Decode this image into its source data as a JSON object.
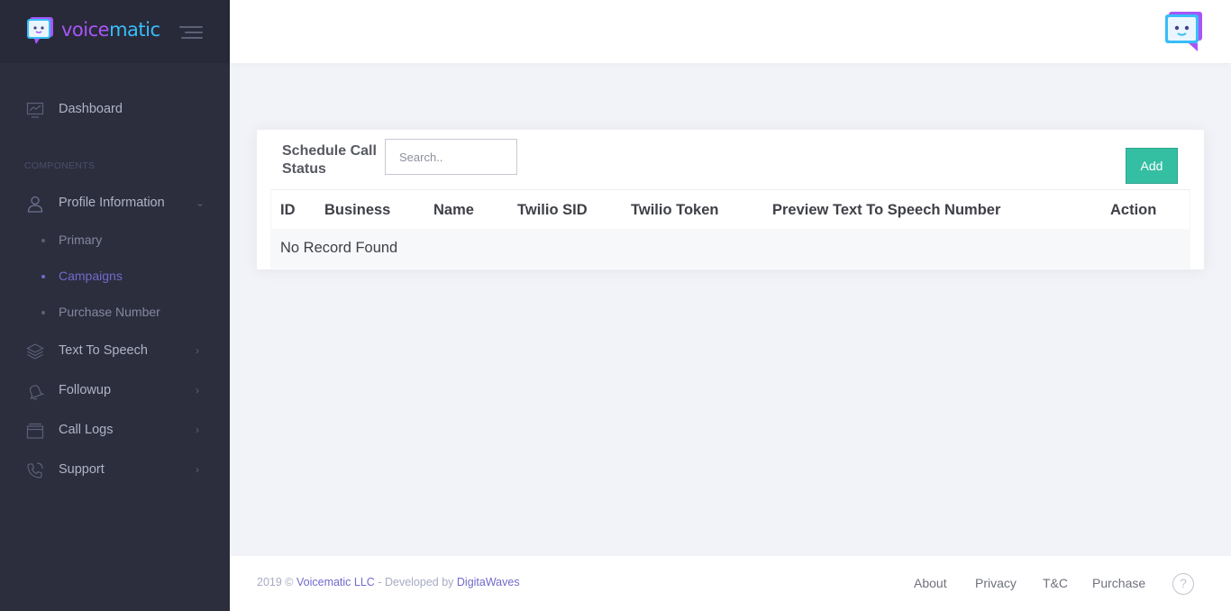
{
  "brand": {
    "name_part1": "voice",
    "name_part2": "matic"
  },
  "sidebar": {
    "dashboard": "Dashboard",
    "section_components": "COMPONENTS",
    "profile_information": "Profile Information",
    "sub_items": [
      "Primary",
      "Campaigns",
      "Purchase Number"
    ],
    "active_sub_item": "Campaigns",
    "text_to_speech": "Text To Speech",
    "followup": "Followup",
    "call_logs": "Call Logs",
    "support": "Support"
  },
  "card": {
    "title": "Schedule Call Status",
    "search_placeholder": "Search..",
    "add_label": "Add"
  },
  "table": {
    "headers": [
      "ID",
      "Business",
      "Name",
      "Twilio SID",
      "Twilio Token",
      "Preview Text To Speech Number",
      "Action"
    ],
    "empty_text": "No Record Found"
  },
  "footer": {
    "year": "2019 ©",
    "company": "Voicematic LLC",
    "developed_by": "- Developed by",
    "developer": "DigitaWaves",
    "links": [
      "About",
      "Privacy",
      "T&C",
      "Purchase"
    ],
    "help": "?"
  },
  "colors": {
    "sidebar_bg": "#2c2e3e",
    "accent": "#716aca",
    "add_button": "#34bfa3"
  }
}
